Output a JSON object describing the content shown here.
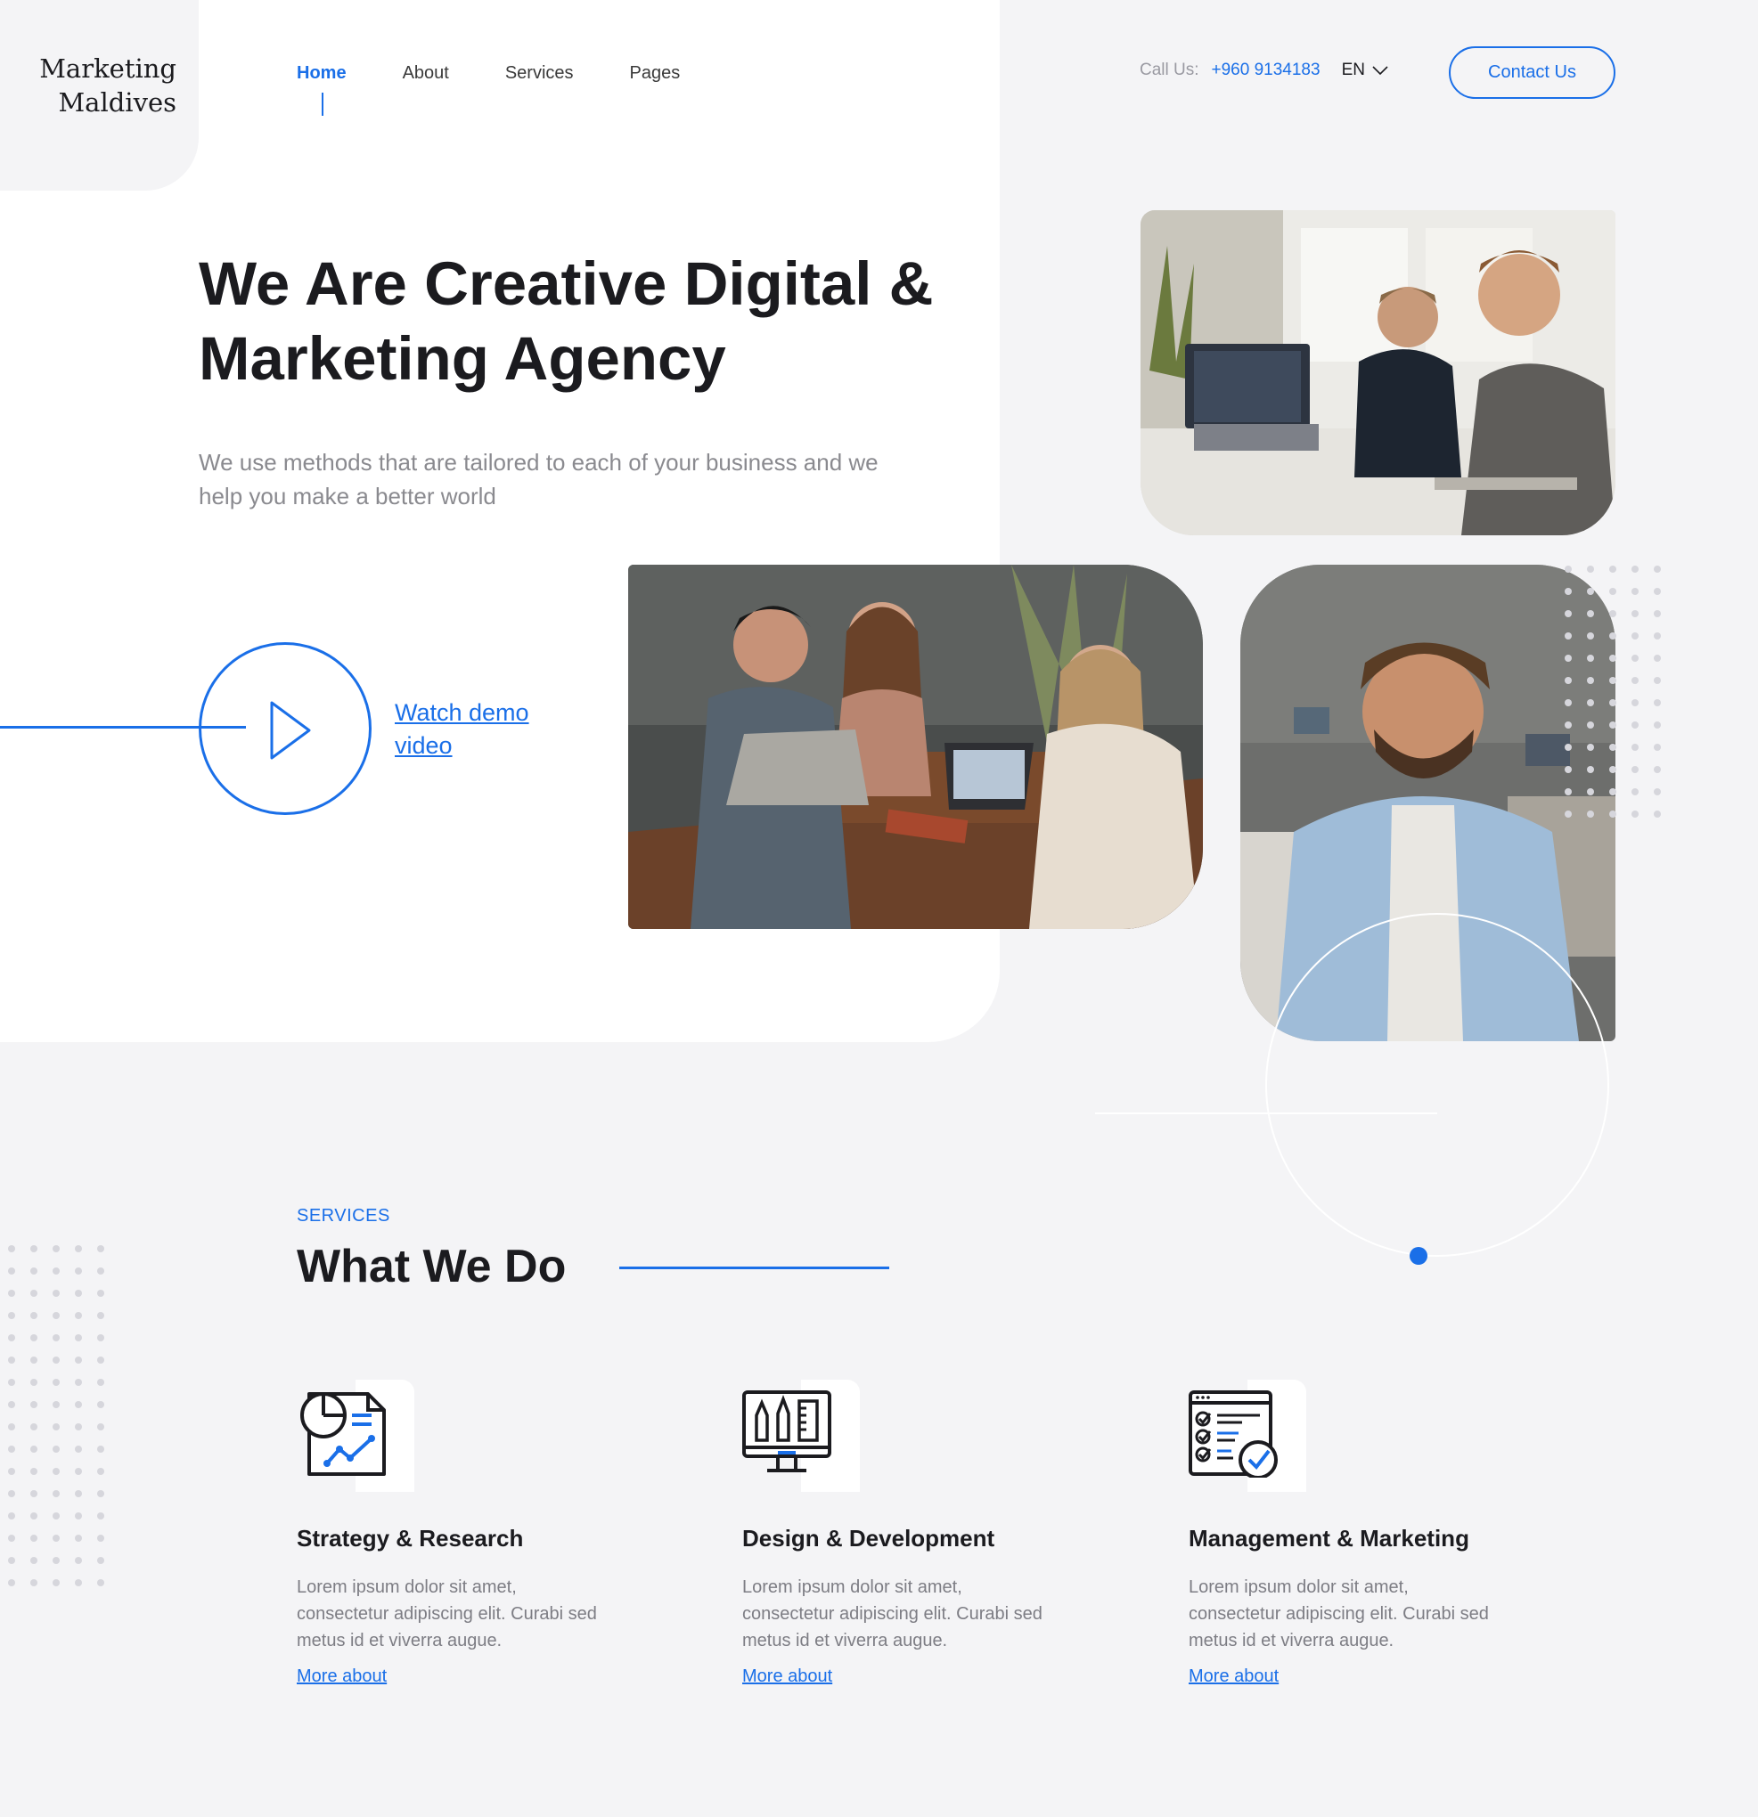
{
  "brand": {
    "logo_line1": "Marketing",
    "logo_line2": "Maldives"
  },
  "nav": {
    "items": [
      {
        "label": "Home",
        "active": true
      },
      {
        "label": "About"
      },
      {
        "label": "Services"
      },
      {
        "label": "Pages"
      }
    ]
  },
  "header": {
    "call_label": "Call Us:",
    "phone": "+960 9134183",
    "language": "EN",
    "contact_button": "Contact Us"
  },
  "hero": {
    "title_line1": "We Are Creative Digital &",
    "title_line2": "Marketing Agency",
    "subtitle": "We use methods that are tailored to each of your business and we help you make a better world",
    "watch_demo_line1": "Watch demo",
    "watch_demo_line2": "video"
  },
  "services": {
    "eyebrow": "SERVICES",
    "title": "What We Do",
    "items": [
      {
        "icon": "report-chart-icon",
        "title": "Strategy & Research",
        "text": "Lorem ipsum dolor sit amet, consectetur adipiscing elit. Curabi sed metus id et viverra augue.",
        "link": "More about"
      },
      {
        "icon": "design-monitor-icon",
        "title": "Design & Development",
        "text": "Lorem ipsum dolor sit amet, consectetur adipiscing elit. Curabi sed metus id et viverra augue.",
        "link": "More about"
      },
      {
        "icon": "checklist-icon",
        "title": "Management & Marketing",
        "text": "Lorem ipsum dolor sit amet, consectetur adipiscing elit. Curabi sed metus id et viverra augue.",
        "link": "More about"
      }
    ]
  },
  "colors": {
    "accent": "#1a6fe8",
    "background": "#f4f4f6",
    "panel": "#ffffff",
    "text": "#1b1b1f",
    "muted": "#8a8a8f"
  }
}
